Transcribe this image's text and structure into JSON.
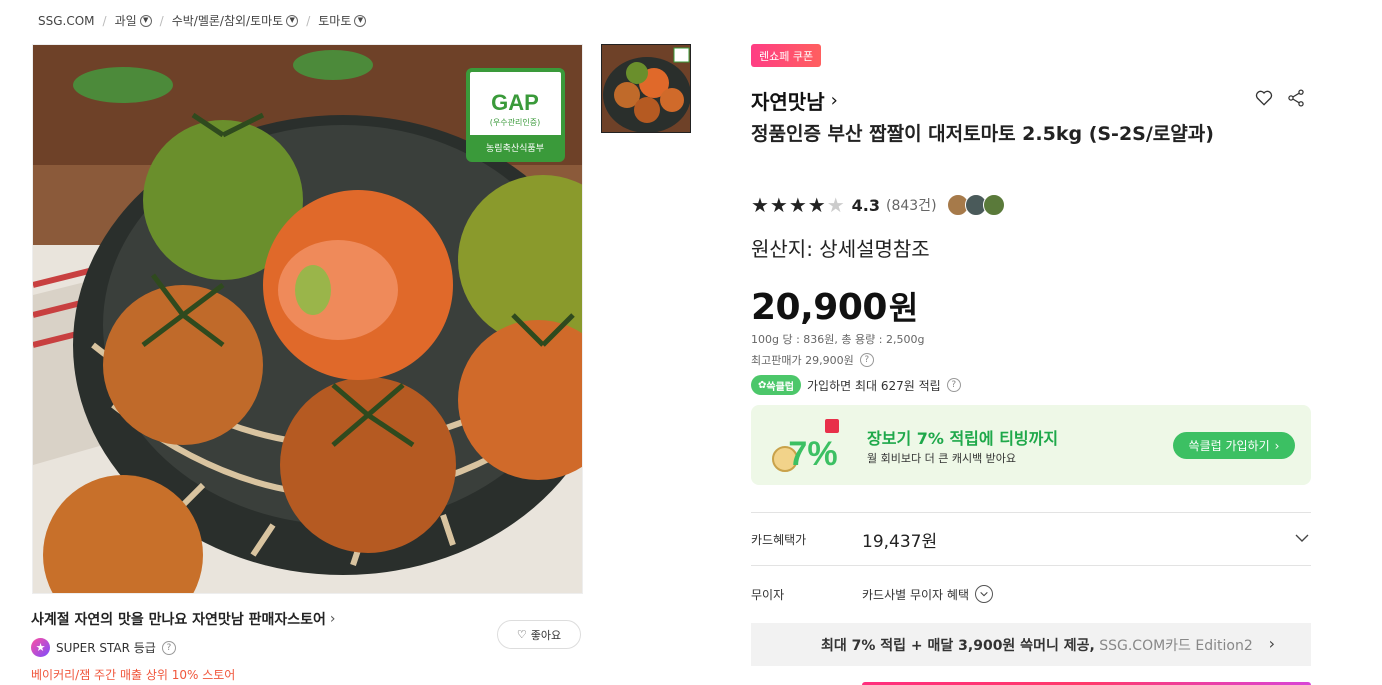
{
  "breadcrumb": {
    "home": "SSG.COM",
    "items": [
      "과일",
      "수박/멜론/참외/토마토",
      "토마토"
    ]
  },
  "product_image": {
    "gap_mark": "GAP",
    "gap_sub": "(우수관리인증)",
    "gap_ministry": "농림축산식품부"
  },
  "seller": {
    "store_line": "사계절 자연의 맛을 만나요 자연맛남 판매자스토어",
    "grade": "SUPER STAR 등급",
    "rank_note": "베이커리/잼 주간 매출 상위 10% 스토어",
    "like_label": "좋아요"
  },
  "product": {
    "coupon_badge": "렌쇼페 쿠폰",
    "brand": "자연맛남",
    "title": "정품인증 부산 짭짤이 대저토마토 2.5kg (S-2S/로얄과)",
    "rating": "4.3",
    "rating_stars": 4.3,
    "review_count": "(843건)",
    "origin": "원산지: 상세설명참조",
    "price_number": "20,900",
    "price_unit": "원",
    "unit_price": "100g 당 : 836원, 총 용량 : 2,500g",
    "max_price": "최고판매가 29,900원",
    "ssg_badge": "쓱클럽",
    "ssg_text": "가입하면 최대 627원 적립"
  },
  "promo": {
    "title": "장보기 7% 적립에 티빙까지",
    "sub": "월 회비보다 더 큰 캐시백 받아요",
    "button": "쓱클럽 가입하기",
    "visual_text": "7%"
  },
  "benefits": {
    "card_label": "카드혜택가",
    "card_value": "19,437원",
    "nointerest_label": "무이자",
    "nointerest_value": "카드사별 무이자 혜택",
    "banner_bold": "최대 7% 적립 + 매달 3,900원 쓱머니 제공,",
    "banner_grey": "SSG.COM카드 Edition2"
  },
  "colors": {
    "accent_green": "#1ea84a",
    "coupon_pink": "#ff3d84",
    "rank_red": "#f0573c"
  }
}
